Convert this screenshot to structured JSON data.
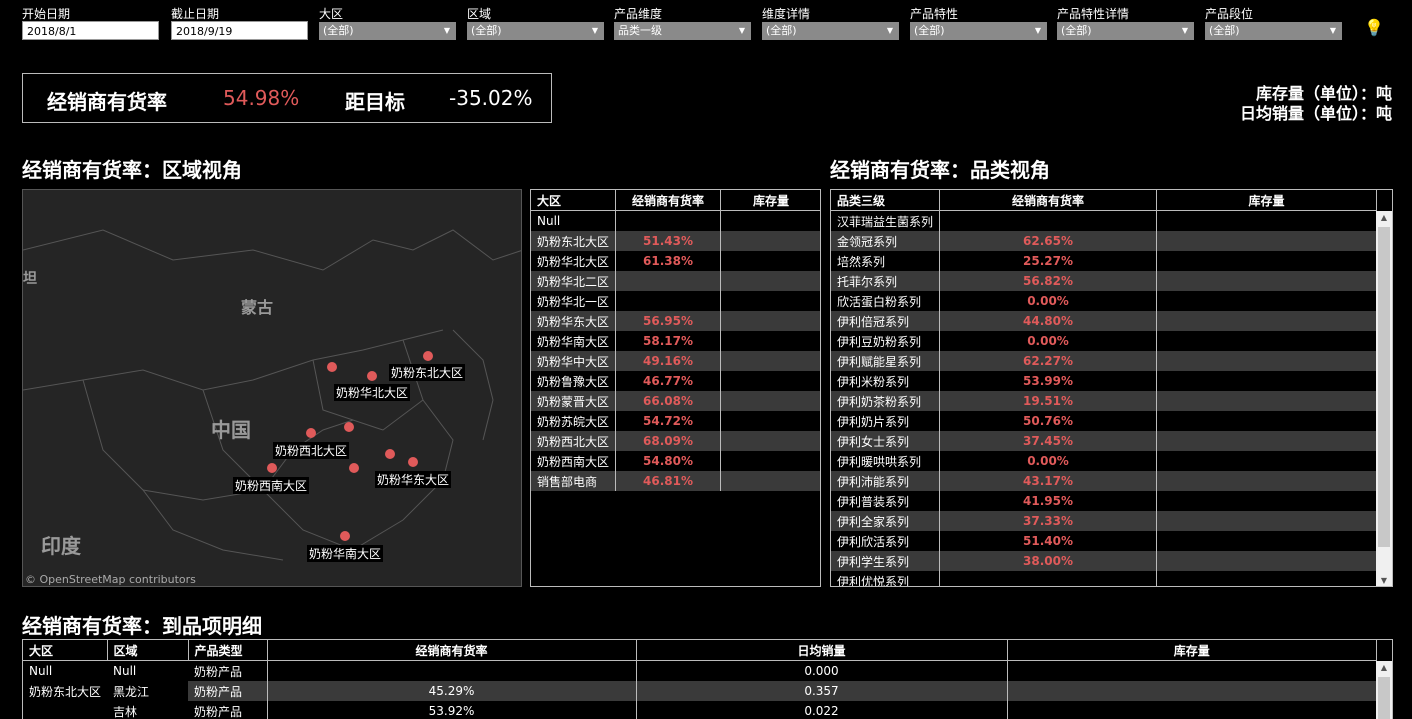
{
  "filters": {
    "start_date": {
      "label": "开始日期",
      "value": "2018/8/1"
    },
    "end_date": {
      "label": "截止日期",
      "value": "2018/9/19"
    },
    "selects": [
      {
        "label": "大区",
        "value": "(全部)"
      },
      {
        "label": "区域",
        "value": "(全部)"
      },
      {
        "label": "产品维度",
        "value": "品类一级"
      },
      {
        "label": "维度详情",
        "value": "(全部)"
      },
      {
        "label": "产品特性",
        "value": "(全部)"
      },
      {
        "label": "产品特性详情",
        "value": "(全部)"
      },
      {
        "label": "产品段位",
        "value": "(全部)"
      }
    ]
  },
  "kpi": {
    "label": "经销商有货率",
    "value": "54.98%",
    "target_label": "距目标",
    "target_value": "-35.02%"
  },
  "units": {
    "stock": "库存量（单位）：吨",
    "daily_sales": "日均销量（单位）：吨"
  },
  "region_section": {
    "title": "经销商有货率：区域视角",
    "map": {
      "country_labels": {
        "mongolia": "蒙古",
        "china": "中国",
        "india": "印度",
        "partial": "坦"
      },
      "region_labels": {
        "northeast": "奶粉东北大区",
        "north": "奶粉华北大区",
        "northwest": "奶粉西北大区",
        "southwest": "奶粉西南大区",
        "east": "奶粉华东大区",
        "south": "奶粉华南大区"
      },
      "attribution": "© OpenStreetMap contributors"
    },
    "table": {
      "headers": [
        "大区",
        "经销商有货率",
        "库存量"
      ],
      "rows": [
        {
          "name": "Null",
          "rate": ""
        },
        {
          "name": "奶粉东北大区",
          "rate": "51.43%"
        },
        {
          "name": "奶粉华北大区",
          "rate": "61.38%"
        },
        {
          "name": "奶粉华北二区",
          "rate": ""
        },
        {
          "name": "奶粉华北一区",
          "rate": ""
        },
        {
          "name": "奶粉华东大区",
          "rate": "56.95%"
        },
        {
          "name": "奶粉华南大区",
          "rate": "58.17%"
        },
        {
          "name": "奶粉华中大区",
          "rate": "49.16%"
        },
        {
          "name": "奶粉鲁豫大区",
          "rate": "46.77%"
        },
        {
          "name": "奶粉蒙晋大区",
          "rate": "66.08%"
        },
        {
          "name": "奶粉苏皖大区",
          "rate": "54.72%"
        },
        {
          "name": "奶粉西北大区",
          "rate": "68.09%"
        },
        {
          "name": "奶粉西南大区",
          "rate": "54.80%"
        },
        {
          "name": "销售部电商",
          "rate": "46.81%"
        }
      ]
    }
  },
  "category_section": {
    "title": "经销商有货率：品类视角",
    "table": {
      "headers": [
        "品类三级",
        "经销商有货率",
        "库存量"
      ],
      "rows": [
        {
          "name": "汉菲瑞益生菌系列",
          "rate": ""
        },
        {
          "name": "金领冠系列",
          "rate": "62.65%"
        },
        {
          "name": "培然系列",
          "rate": "25.27%"
        },
        {
          "name": "托菲尔系列",
          "rate": "56.82%"
        },
        {
          "name": "欣活蛋白粉系列",
          "rate": "0.00%"
        },
        {
          "name": "伊利倍冠系列",
          "rate": "44.80%"
        },
        {
          "name": "伊利豆奶粉系列",
          "rate": "0.00%"
        },
        {
          "name": "伊利赋能星系列",
          "rate": "62.27%"
        },
        {
          "name": "伊利米粉系列",
          "rate": "53.99%"
        },
        {
          "name": "伊利奶茶粉系列",
          "rate": "19.51%"
        },
        {
          "name": "伊利奶片系列",
          "rate": "50.76%"
        },
        {
          "name": "伊利女士系列",
          "rate": "37.45%"
        },
        {
          "name": "伊利暖哄哄系列",
          "rate": "0.00%"
        },
        {
          "name": "伊利沛能系列",
          "rate": "43.17%"
        },
        {
          "name": "伊利普装系列",
          "rate": "41.95%"
        },
        {
          "name": "伊利全家系列",
          "rate": "37.33%"
        },
        {
          "name": "伊利欣活系列",
          "rate": "51.40%"
        },
        {
          "name": "伊利学生系列",
          "rate": "38.00%"
        },
        {
          "name": "伊利优悦系列",
          "rate": ""
        }
      ]
    }
  },
  "detail_section": {
    "title": "经销商有货率：到品项明细",
    "table": {
      "headers": [
        "大区",
        "区域",
        "产品类型",
        "经销商有货率",
        "日均销量",
        "库存量"
      ],
      "rows": [
        {
          "region": "Null",
          "area": "Null",
          "type": "奶粉产品",
          "rate": "",
          "sales": "0.000"
        },
        {
          "region": "奶粉东北大区",
          "area": "黑龙江",
          "type": "奶粉产品",
          "rate": "45.29%",
          "sales": "0.357"
        },
        {
          "region": "",
          "area": "吉林",
          "type": "奶粉产品",
          "rate": "53.92%",
          "sales": "0.022"
        }
      ]
    }
  }
}
